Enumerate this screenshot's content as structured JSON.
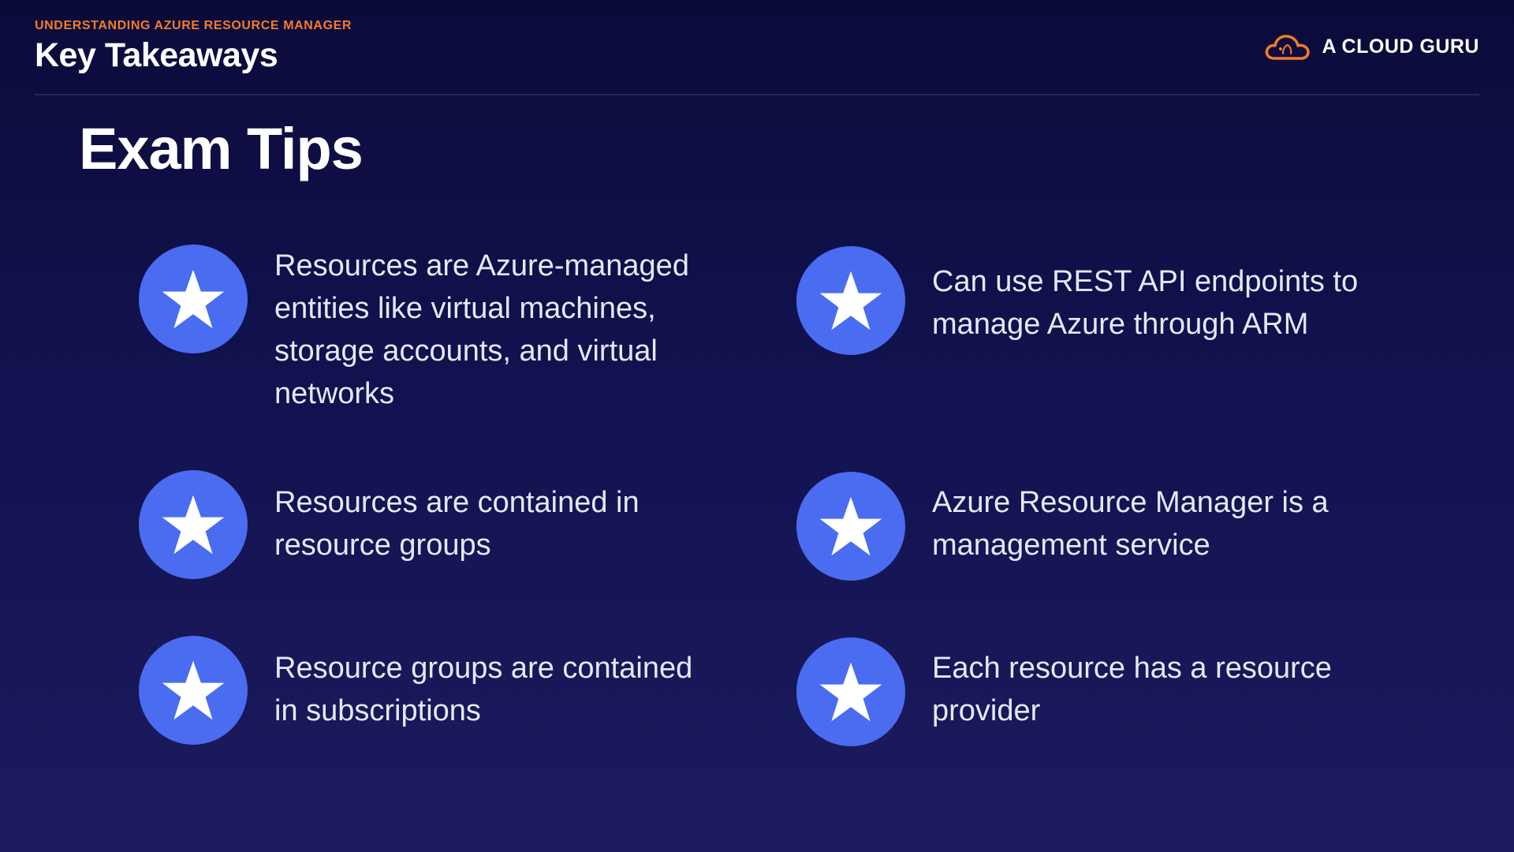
{
  "header": {
    "kicker": "UNDERSTANDING AZURE RESOURCE MANAGER",
    "section_title": "Key Takeaways"
  },
  "brand": {
    "name": "A CLOUD GURU",
    "icon": "cloud-icon",
    "accent_color": "#f47b2a"
  },
  "page_title": "Exam Tips",
  "tips": [
    {
      "text": "Resources are Azure-managed entities like virtual machines, storage accounts, and virtual networks",
      "icon": "star-icon"
    },
    {
      "text": "Can use REST API endpoints to manage Azure through ARM",
      "icon": "star-icon"
    },
    {
      "text": "Resources are contained in resource groups",
      "icon": "star-icon"
    },
    {
      "text": "Azure Resource Manager is a management service",
      "icon": "star-icon"
    },
    {
      "text": "Resource groups are contained in subscriptions",
      "icon": "star-icon"
    },
    {
      "text": "Each resource has a resource provider",
      "icon": "star-icon"
    }
  ],
  "colors": {
    "background": "#121250",
    "badge": "#4a6cf0",
    "accent": "#f47b2a"
  }
}
